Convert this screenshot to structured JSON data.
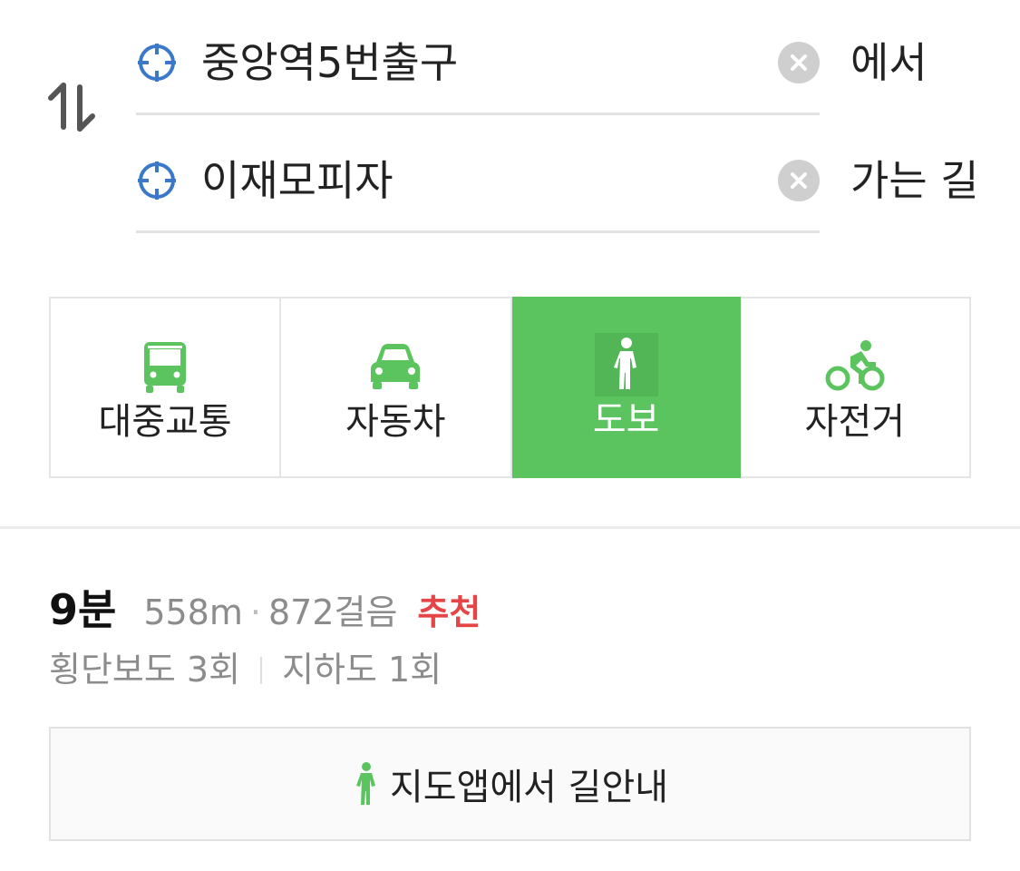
{
  "route": {
    "origin": {
      "value": "중앙역5번출구",
      "suffix": "에서",
      "icon": "crosshair-icon",
      "clear_icon": "clear-icon"
    },
    "destination": {
      "value": "이재모피자",
      "suffix": "가는 길",
      "icon": "crosshair-icon",
      "clear_icon": "clear-icon"
    },
    "swap_icon": "swap-vertical-icon"
  },
  "modes": [
    {
      "label": "대중교통",
      "icon": "bus-icon",
      "active": false
    },
    {
      "label": "자동차",
      "icon": "car-icon",
      "active": false
    },
    {
      "label": "도보",
      "icon": "walking-icon",
      "active": true
    },
    {
      "label": "자전거",
      "icon": "bicycle-icon",
      "active": false
    }
  ],
  "result": {
    "time": "9분",
    "distance": "558m",
    "separator": "·",
    "steps": "872걸음",
    "badge": "추천",
    "crosswalks": "횡단보도 3회",
    "underpasses": "지하도 1회"
  },
  "navigation": {
    "label": "지도앱에서 길안내",
    "icon": "walking-icon"
  },
  "colors": {
    "accent": "#5bc45f",
    "badge": "#e64545",
    "icon_blue": "#3a78c9",
    "muted": "#8c8c8c"
  }
}
